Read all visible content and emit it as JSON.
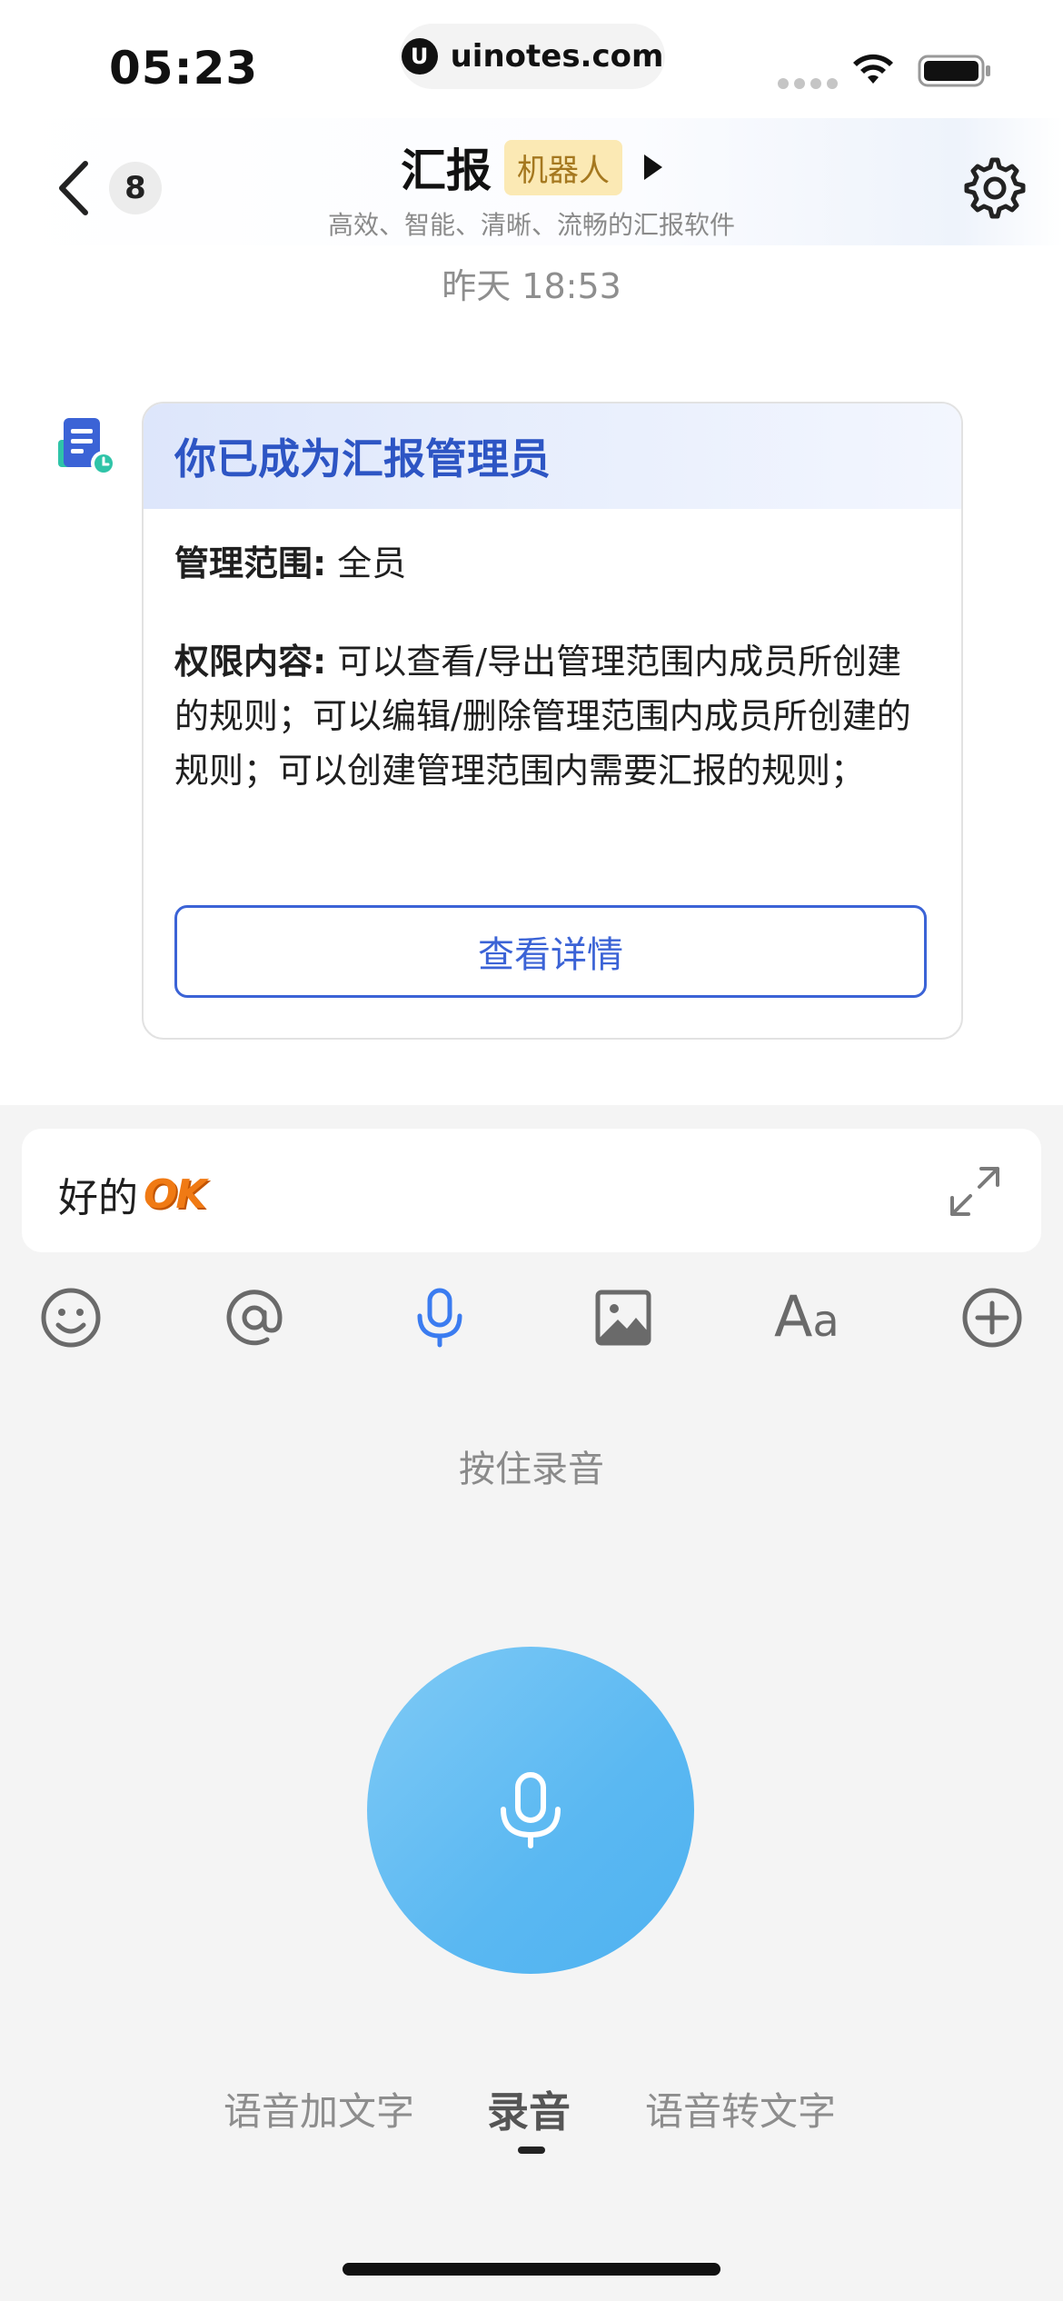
{
  "status_bar": {
    "time": "05:23",
    "url_logo": "U",
    "url": "uinotes.com"
  },
  "header": {
    "unread_count": "8",
    "title": "汇报",
    "tag": "机器人",
    "subtitle": "高效、智能、清晰、流畅的汇报软件"
  },
  "chat": {
    "timestamp": "昨天 18:53",
    "card": {
      "title": "你已成为汇报管理员",
      "scope_label": "管理范围:",
      "scope_value": "全员",
      "permission_label": "权限内容:",
      "permission_value": "可以查看/导出管理范围内成员所创建的规则；可以编辑/删除管理范围内成员所创建的规则；可以创建管理范围内需要汇报的规则；",
      "button_label": "查看详情"
    }
  },
  "composer": {
    "input_text": "好的",
    "sticker_text": "OK",
    "toolbar_icons": [
      "emoji-icon",
      "at-icon",
      "microphone-icon",
      "image-icon",
      "font-icon",
      "plus-circle-icon"
    ],
    "font_icon_big": "A",
    "font_icon_small": "a",
    "hold_hint": "按住录音"
  },
  "voice_modes": {
    "tabs": [
      "语音加文字",
      "录音",
      "语音转文字"
    ],
    "active_index": 1
  },
  "colors": {
    "accent_blue": "#3b63d6",
    "record_blue": "#5ab8f2",
    "tag_bg": "#fbe9b4",
    "tag_text": "#a5781f",
    "panel_bg": "#f4f4f4"
  }
}
